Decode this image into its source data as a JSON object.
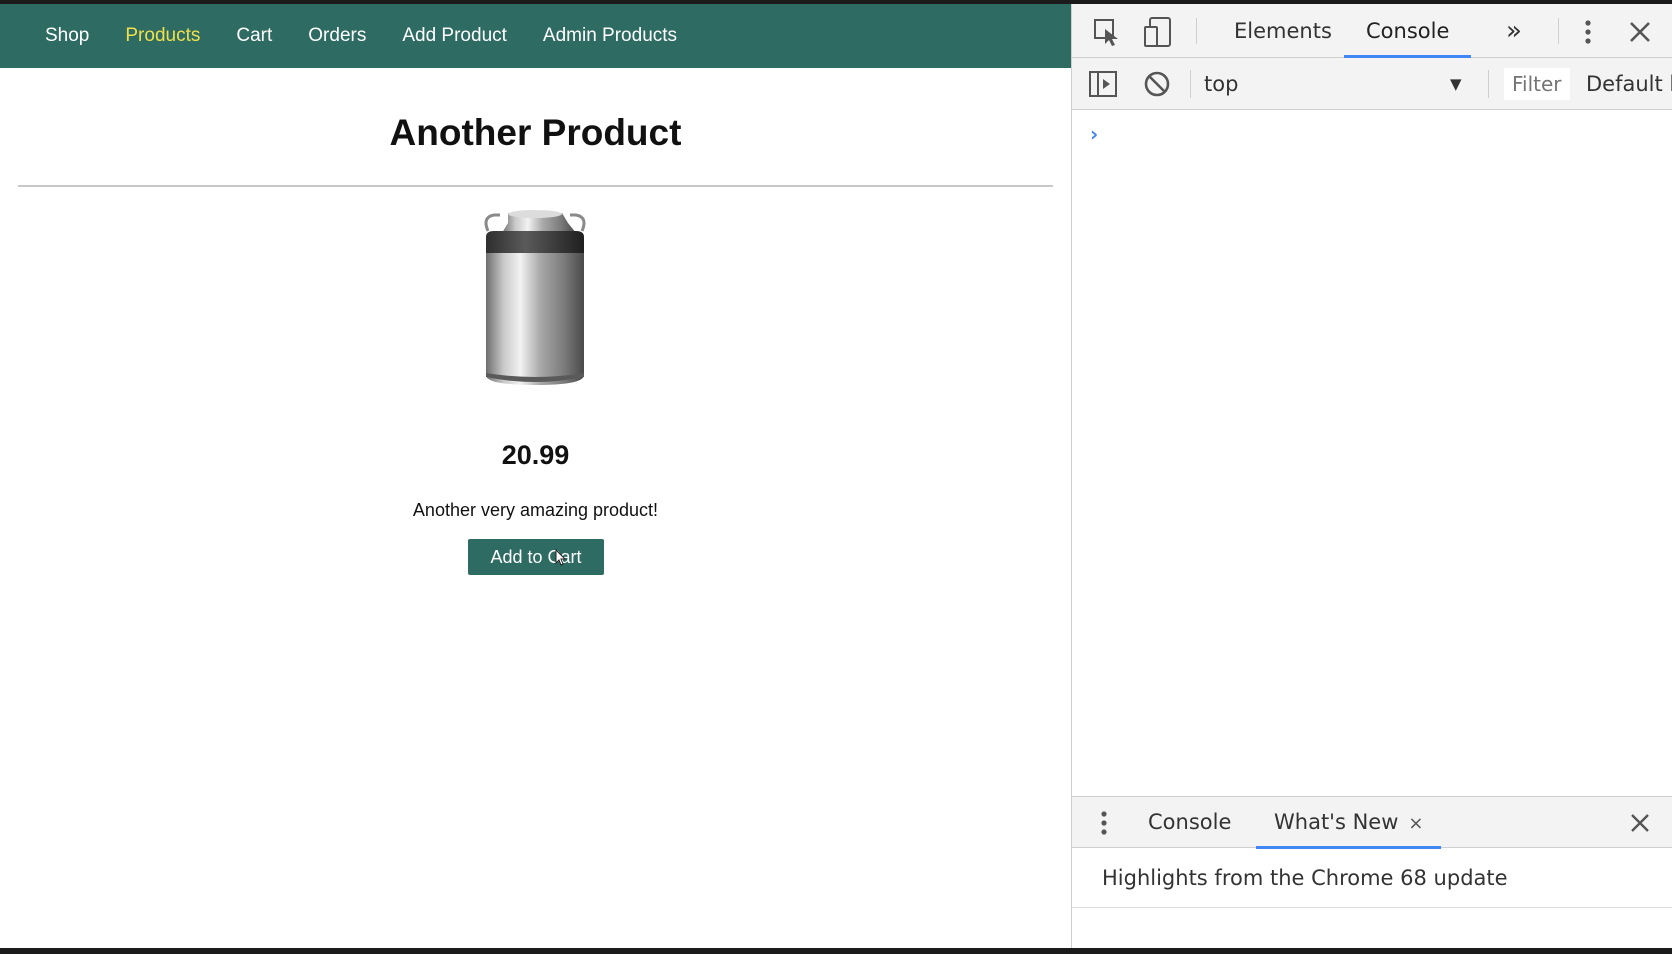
{
  "nav": {
    "items": [
      {
        "label": "Shop",
        "active": false
      },
      {
        "label": "Products",
        "active": true
      },
      {
        "label": "Cart",
        "active": false
      },
      {
        "label": "Orders",
        "active": false
      },
      {
        "label": "Add Product",
        "active": false
      },
      {
        "label": "Admin Products",
        "active": false
      }
    ]
  },
  "product": {
    "title": "Another Product",
    "price": "20.99",
    "description": "Another very amazing product!",
    "add_to_cart_label": "Add to Cart",
    "image_icon": "milk-can-image"
  },
  "devtools": {
    "tabs": [
      {
        "label": "Elements",
        "selected": false
      },
      {
        "label": "Console",
        "selected": true
      }
    ],
    "more_tabs_glyph": "»",
    "context": "top",
    "filter_placeholder": "Filter",
    "levels_label": "Default l",
    "prompt_glyph": "›",
    "drawer": {
      "tabs": [
        {
          "label": "Console",
          "selected": false
        },
        {
          "label": "What's New",
          "selected": true
        }
      ],
      "tab_close_glyph": "×",
      "highlights_text": "Highlights from the Chrome 68 update"
    }
  },
  "colors": {
    "nav_bg": "#2e6b62",
    "nav_active": "#f0e04a",
    "button_bg": "#2e6b62",
    "devtools_accent": "#4285f4"
  }
}
